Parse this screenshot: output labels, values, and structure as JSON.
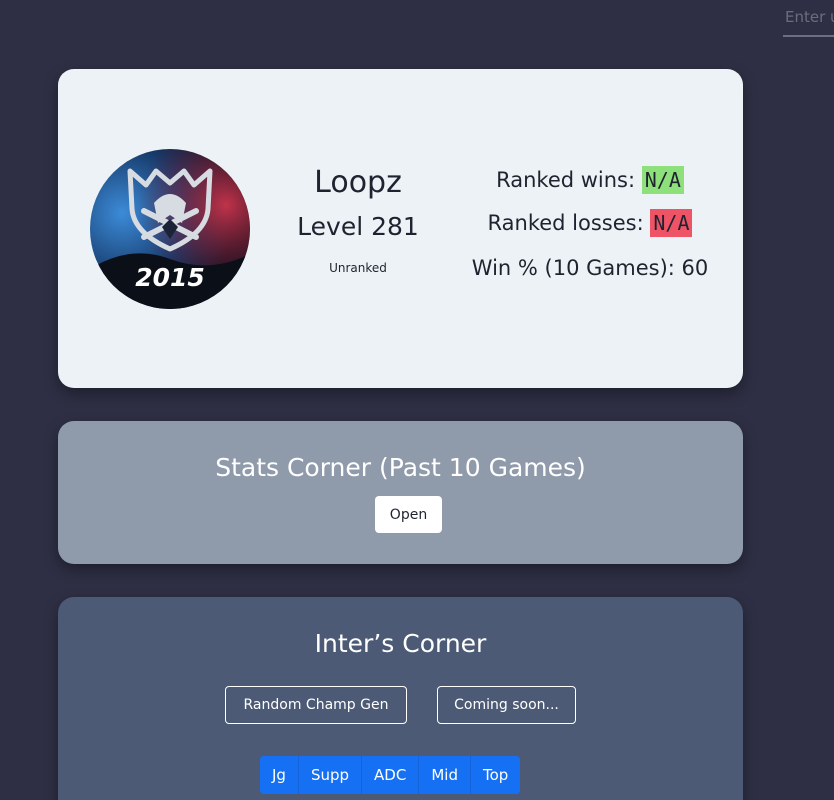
{
  "search": {
    "placeholder": "Enter username"
  },
  "profile": {
    "emblem_text": "2015",
    "name": "Loopz",
    "level": "Level 281",
    "rank": "Unranked",
    "wins_label": "Ranked wins:",
    "wins_value": "N/A",
    "losses_label": "Ranked losses:",
    "losses_value": "N/A",
    "winrate": "Win % (10 Games): 60"
  },
  "stats_corner": {
    "title": "Stats Corner (Past 10 Games)",
    "open_label": "Open"
  },
  "inters_corner": {
    "title": "Inter’s Corner",
    "random_champ_label": "Random Champ Gen",
    "coming_soon_label": "Coming soon...",
    "roles": [
      "Jg",
      "Supp",
      "ADC",
      "Mid",
      "Top"
    ]
  },
  "colors": {
    "background": "#2e2f44",
    "profile_card": "#edf2f6",
    "stats_card": "#8f9aab",
    "inter_card": "#4c5a75",
    "win_badge": "#8ee07a",
    "loss_badge": "#ef5466",
    "role_button": "#1670f4"
  },
  "icons": {
    "avatar": "worlds-2015-emblem-icon"
  }
}
